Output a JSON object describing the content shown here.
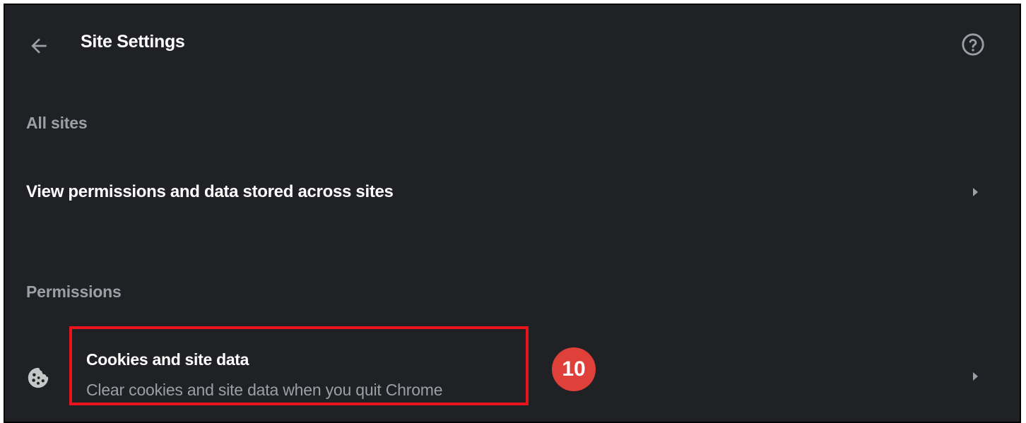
{
  "header": {
    "back_icon": "arrow-left-icon",
    "title": "Site Settings",
    "help_icon": "help-circle-icon"
  },
  "sections": {
    "all_sites_label": "All sites",
    "all_sites_row": {
      "label": "View permissions and data stored across sites",
      "icon": "chevron-right-icon"
    },
    "permissions_label": "Permissions",
    "cookies_row": {
      "icon": "cookie-icon",
      "title": "Cookies and site data",
      "subtitle": "Clear cookies and site data when you quit Chrome",
      "chevron_icon": "chevron-right-icon"
    }
  },
  "annotation": {
    "step_number": "10",
    "highlight_color": "#e8131b",
    "badge_color": "#e0403a"
  },
  "colors": {
    "background": "#202124",
    "primary_text": "#ffffff",
    "secondary_text": "#9aa0a6"
  }
}
